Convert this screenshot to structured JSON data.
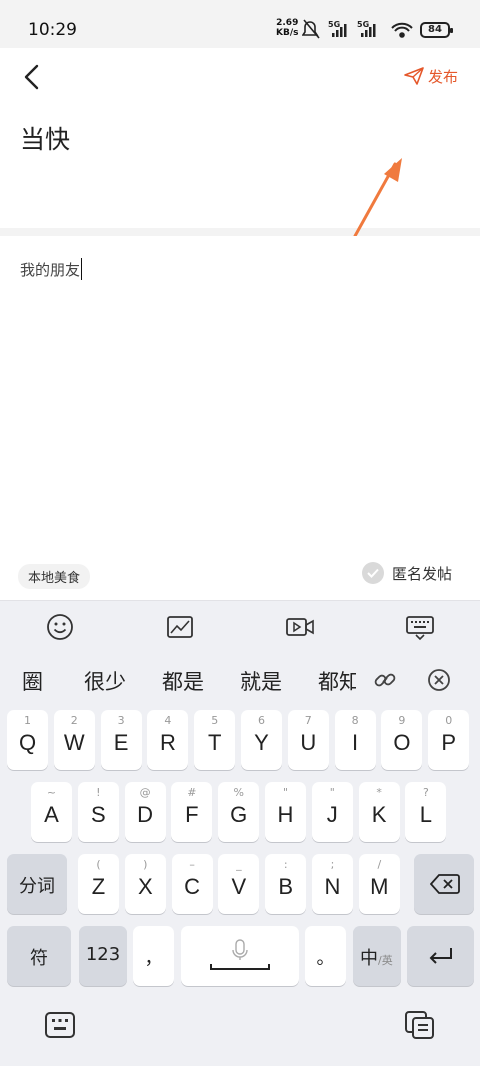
{
  "status": {
    "time": "10:29",
    "speed_top": "2.69",
    "speed_bottom": "KB/s",
    "battery": "84",
    "net1": "5G",
    "net2": "5G"
  },
  "header": {
    "publish_label": "发布",
    "title": "当快"
  },
  "editor": {
    "content": "我的朋友",
    "tag": "本地美食",
    "anonymous_label": "匿名发帖"
  },
  "suggestions": [
    "圈",
    "很少",
    "都是",
    "就是",
    "都知"
  ],
  "keyboard": {
    "row1": [
      {
        "k": "Q",
        "s": "1"
      },
      {
        "k": "W",
        "s": "2"
      },
      {
        "k": "E",
        "s": "3"
      },
      {
        "k": "R",
        "s": "4"
      },
      {
        "k": "T",
        "s": "5"
      },
      {
        "k": "Y",
        "s": "6"
      },
      {
        "k": "U",
        "s": "7"
      },
      {
        "k": "I",
        "s": "8"
      },
      {
        "k": "O",
        "s": "9"
      },
      {
        "k": "P",
        "s": "0"
      }
    ],
    "row2": [
      {
        "k": "A",
        "s": "~"
      },
      {
        "k": "S",
        "s": "!"
      },
      {
        "k": "D",
        "s": "@"
      },
      {
        "k": "F",
        "s": "#"
      },
      {
        "k": "G",
        "s": "%"
      },
      {
        "k": "H",
        "s": "\""
      },
      {
        "k": "J",
        "s": "\""
      },
      {
        "k": "K",
        "s": "*"
      },
      {
        "k": "L",
        "s": "?"
      }
    ],
    "row3": [
      {
        "k": "Z",
        "s": "("
      },
      {
        "k": "X",
        "s": ")"
      },
      {
        "k": "C",
        "s": "–"
      },
      {
        "k": "V",
        "s": "_"
      },
      {
        "k": "B",
        "s": ":"
      },
      {
        "k": "N",
        "s": ";"
      },
      {
        "k": "M",
        "s": "/"
      }
    ],
    "segment_label": "分词",
    "symbol_label": "符",
    "num_label": "123",
    "comma": "，",
    "period": "。",
    "lang_main": "中",
    "lang_sub": "/英"
  }
}
